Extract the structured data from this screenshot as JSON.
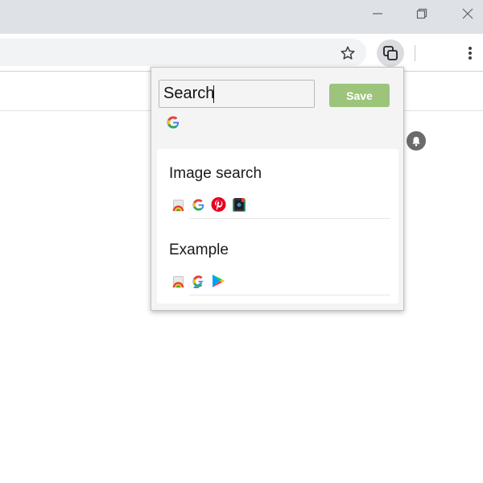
{
  "window": {
    "controls": [
      "minimize-icon",
      "restore-icon",
      "close-icon"
    ]
  },
  "toolbar": {
    "icons": [
      "star-icon",
      "extension-icon",
      "more-vert-icon"
    ]
  },
  "popup": {
    "search": {
      "value": "Search",
      "placeholder": ""
    },
    "save_label": "Save",
    "default_engine_icon": "google-icon",
    "groups": [
      {
        "title": "Image search",
        "engines": [
          "rainbow-image-search-icon",
          "google-icon",
          "pinterest-icon",
          "tineye-icon"
        ]
      },
      {
        "title": "Example",
        "engines": [
          "rainbow-image-search-icon",
          "google-icon",
          "google-play-icon"
        ]
      }
    ]
  },
  "page": {
    "notification_icon": "bell-icon"
  },
  "colors": {
    "titlebar": "#dee1e6",
    "save_button": "#9cc47a",
    "popup_bg": "#f4f4f4"
  }
}
